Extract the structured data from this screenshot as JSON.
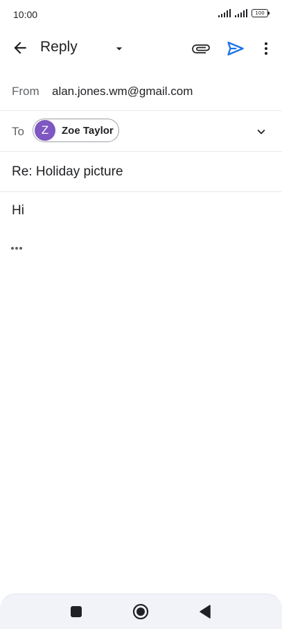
{
  "status_bar": {
    "time": "10:00",
    "battery": "100"
  },
  "toolbar": {
    "title": "Reply",
    "back_icon": "arrow-left-icon",
    "dropdown_icon": "caret-down-icon",
    "attach_icon": "paperclip-icon",
    "send_icon": "send-icon",
    "more_icon": "more-vert-icon",
    "send_color": "#1a73e8"
  },
  "from": {
    "label": "From",
    "value": "alan.jones.wm@gmail.com"
  },
  "to": {
    "label": "To",
    "recipient": {
      "initial": "Z",
      "name": "Zoe Taylor",
      "avatar_color": "#7e57c2"
    },
    "expand_icon": "chevron-down-icon"
  },
  "subject": {
    "value": "Re: Holiday picture"
  },
  "body": {
    "text": "Hi",
    "quoted_toggle_icon": "more-horiz-icon"
  },
  "nav_bar": {
    "recent_icon": "square-icon",
    "home_icon": "circle-icon",
    "back_icon": "triangle-back-icon"
  }
}
